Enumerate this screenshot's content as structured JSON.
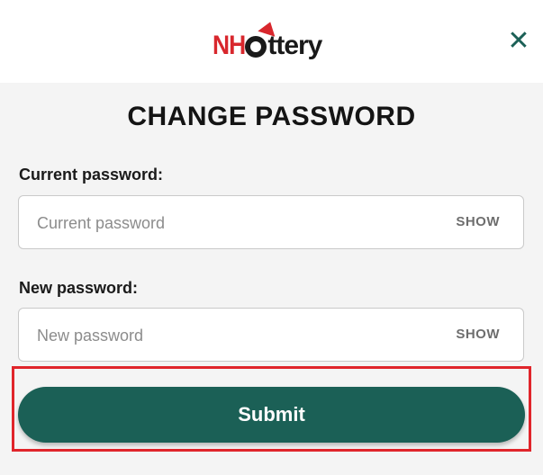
{
  "header": {
    "logo_prefix": "NH",
    "logo_suffix": "ttery",
    "close_glyph": "✕"
  },
  "form": {
    "title": "CHANGE PASSWORD",
    "current_password": {
      "label": "Current password:",
      "placeholder": "Current password",
      "value": "",
      "toggle": "SHOW"
    },
    "new_password": {
      "label": "New password:",
      "placeholder": "New password",
      "value": "",
      "toggle": "SHOW"
    },
    "submit_label": "Submit"
  },
  "colors": {
    "brand_green": "#1b6056",
    "logo_red": "#d8272d",
    "highlight_red": "#e0252b",
    "page_bg": "#f4f4f4"
  },
  "icons": {
    "close": "close-icon",
    "logo_ball": "lottery-ball-icon"
  }
}
